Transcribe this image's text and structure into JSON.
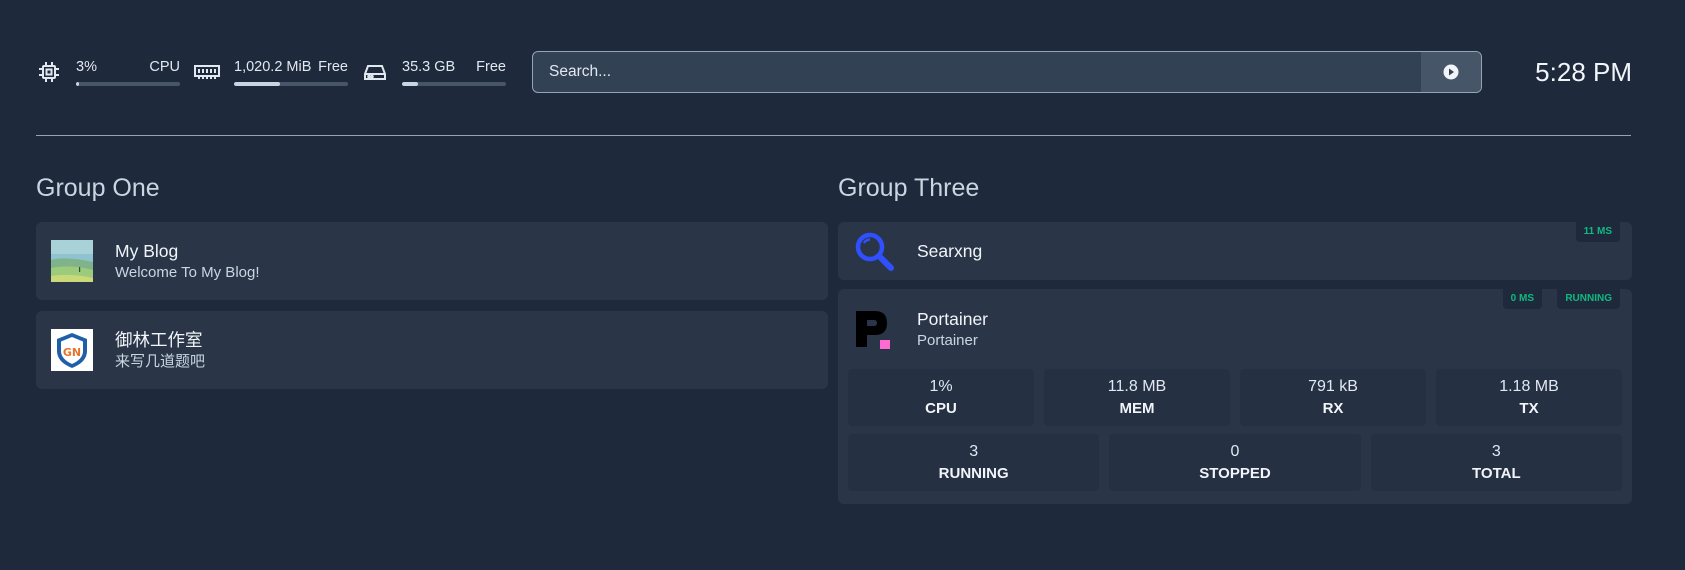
{
  "resources": {
    "cpu": {
      "value": "3%",
      "label": "CPU",
      "percent": 3,
      "icon": "cpu-icon"
    },
    "memory": {
      "value": "1,020.2 MiB",
      "label": "Free",
      "percent": 40,
      "icon": "memory-icon"
    },
    "disk": {
      "value": "35.3 GB",
      "label": "Free",
      "percent": 15,
      "icon": "disk-icon"
    }
  },
  "search": {
    "placeholder": "Search...",
    "button_icon": "search-provider-icon"
  },
  "clock": "5:28 PM",
  "groups": [
    {
      "title": "Group One",
      "services": [
        {
          "name": "My Blog",
          "description": "Welcome To My Blog!",
          "icon": "blog-thumbnail"
        },
        {
          "name": "御林工作室",
          "description": "来写几道题吧",
          "icon": "yulin-logo"
        }
      ]
    },
    {
      "title": "Group Three",
      "services": [
        {
          "name": "Searxng",
          "icon": "searxng-icon",
          "ping": "11 MS"
        },
        {
          "name": "Portainer",
          "description": "Portainer",
          "icon": "portainer-icon",
          "ping": "0 MS",
          "status": "RUNNING",
          "stats": [
            {
              "value": "1%",
              "label": "CPU"
            },
            {
              "value": "11.8 MB",
              "label": "MEM"
            },
            {
              "value": "791 kB",
              "label": "RX"
            },
            {
              "value": "1.18 MB",
              "label": "TX"
            }
          ],
          "containers": [
            {
              "value": "3",
              "label": "RUNNING"
            },
            {
              "value": "0",
              "label": "STOPPED"
            },
            {
              "value": "3",
              "label": "TOTAL"
            }
          ]
        }
      ]
    }
  ],
  "colors": {
    "background": "#1e293b",
    "card": "#2a3648",
    "accent_green": "#10b981"
  }
}
